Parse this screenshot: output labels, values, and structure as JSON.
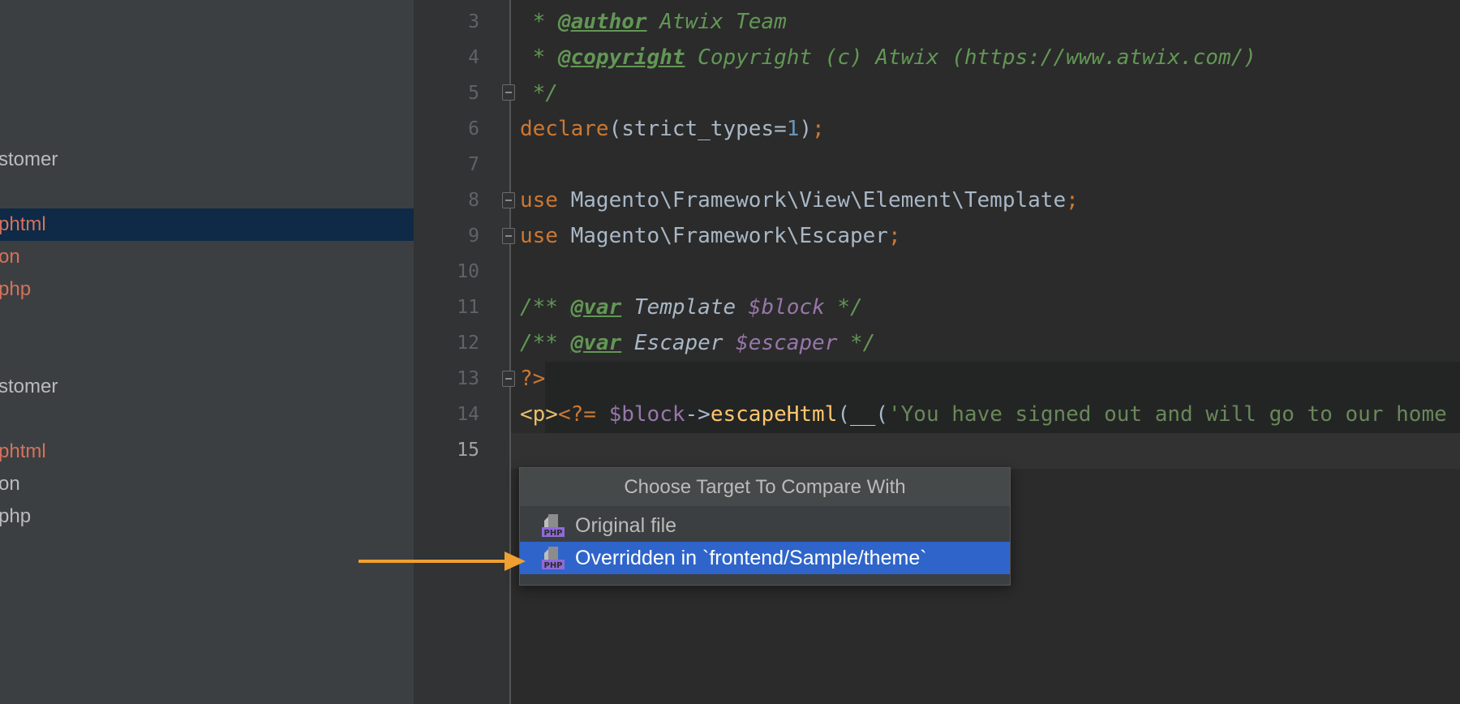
{
  "sidebar": {
    "items": [
      {
        "text": "stomer",
        "state": "default"
      },
      {
        "text": "phtml",
        "state": "modified"
      },
      {
        "text": "on",
        "state": "modified"
      },
      {
        "text": "php",
        "state": "modified"
      },
      {
        "text": "stomer",
        "state": "default"
      },
      {
        "text": "phtml",
        "state": "modified"
      },
      {
        "text": "on",
        "state": "default"
      },
      {
        "text": "php",
        "state": "default"
      }
    ]
  },
  "editor": {
    "line_numbers": [
      "3",
      "4",
      "5",
      "6",
      "7",
      "8",
      "9",
      "10",
      "11",
      "12",
      "13",
      "14",
      "15"
    ],
    "current_line": "15",
    "code": {
      "l3": {
        "star": " * ",
        "tag": "@author",
        "text": " Atwix Team"
      },
      "l4": {
        "star": " * ",
        "tag": "@copyright",
        "text": " Copyright (c) Atwix (https://www.atwix.com/)"
      },
      "l5": {
        "text": " */"
      },
      "l6": {
        "kw": "declare",
        "open": "(strict_types=",
        "num": "1",
        "close": ")",
        "semi": ";"
      },
      "l8": {
        "kw": "use",
        "text": " Magento\\Framework\\View\\Element\\Template",
        "semi": ";"
      },
      "l9": {
        "kw": "use",
        "text": " Magento\\Framework\\Escaper",
        "semi": ";"
      },
      "l11": {
        "open": "/** ",
        "tag": "@var",
        "type": " Template ",
        "var": "$block",
        "close": " */"
      },
      "l12": {
        "open": "/** ",
        "tag": "@var",
        "type": " Escaper ",
        "var": "$escaper",
        "close": " */"
      },
      "l13": {
        "text": "?>"
      },
      "l14": {
        "ptag": "<p>",
        "phpopen": "<?=",
        "space": " ",
        "var": "$block",
        "arrow": "->",
        "fn": "escapeHtml",
        "paren": "(",
        "fn2": "__",
        "paren2": "(",
        "str": "'You have signed out and will go to our home"
      }
    }
  },
  "popup": {
    "title": "Choose Target To Compare With",
    "items": [
      {
        "label": "Original file",
        "icon": "php-file-icon"
      },
      {
        "label": "Overridden in `frontend/Sample/theme`",
        "icon": "php-file-icon"
      }
    ],
    "icon_text": "PHP"
  },
  "colors": {
    "accent_selection": "#2f65ca",
    "arrow": "#f0a030"
  }
}
